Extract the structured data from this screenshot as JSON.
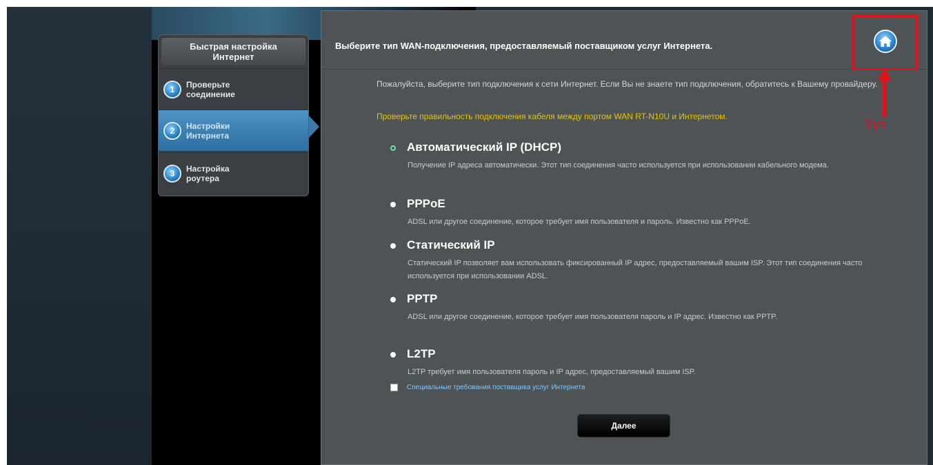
{
  "wizard": {
    "title": "Быстрая настройка\nИнтернет",
    "steps": [
      {
        "number": "1",
        "label": "Проверьте\nсоединение",
        "state": "done"
      },
      {
        "number": "2",
        "label": "Настройки\nИнтернета",
        "state": "active"
      },
      {
        "number": "3",
        "label": "Настройка\nроутера",
        "state": "pending"
      }
    ]
  },
  "main": {
    "title": "Выберите тип WAN-подключения, предоставляемый поставщиком услуг Интернета.",
    "intro": "Пожалуйста, выберите тип подключения к сети Интернет. Если Вы не знаете тип подключения, обратитесь к Вашему провайдеру.",
    "warning": "Проверьте правильность подключения кабеля между портом WAN RT-N10U и Интернетом.",
    "options": [
      {
        "name": "Автоматический IP (DHCP)",
        "desc": "Получение IP адреса автоматически. Этот тип соединения часто используется при использовании кабельного модема.",
        "selected": true
      },
      {
        "name": "PPPoE",
        "desc": "ADSL или другое соединение, которое требует имя пользователя и пароль. Известно как PPPoE.",
        "selected": false
      },
      {
        "name": "Статический IP",
        "desc": "Статический IP позволяет вам использовать фиксированный IP адрес, предоставляемый вашим ISP. Этот тип соединения часто используется при использовании ADSL.",
        "selected": false
      },
      {
        "name": "PPTP",
        "desc": "ADSL или другое соединение, которое требует имя пользователя пароль и IP адрес. Известно как PPTP.",
        "selected": false
      },
      {
        "name": "L2TP",
        "desc": "L2TP требует имя пользователя пароль и IP адрес, предоставляемый вашим ISP.",
        "selected": false
      }
    ],
    "special_requirements_label": "Специальные требования поставщика услуг Интернета",
    "special_requirements_checked": false,
    "next_label": "Далее",
    "home_icon": "home-icon"
  },
  "annotation": {
    "label": "Тут",
    "color": "#e0111b"
  },
  "colors": {
    "background": "#1f2a33",
    "panel": "#4e5356",
    "active_step": "#3d79a8",
    "warning": "#e8c400",
    "link": "#7fc8ff"
  }
}
